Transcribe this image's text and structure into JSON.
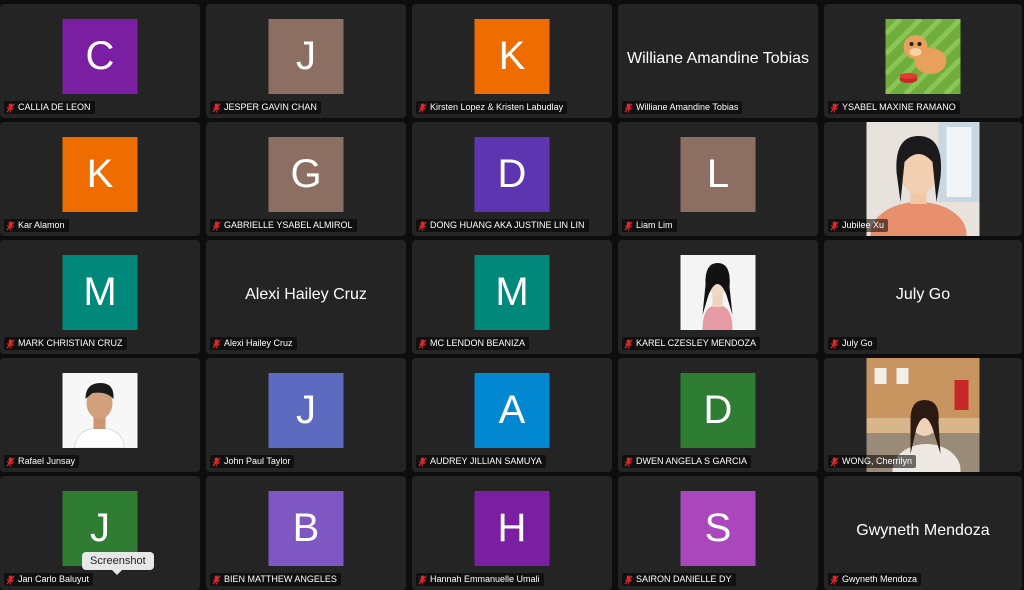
{
  "participants": [
    {
      "name": "CALLIA DE LEON",
      "initial": "C",
      "color": "#7b1fa2",
      "kind": "avatar",
      "muted": true
    },
    {
      "name": "JESPER GAVIN CHAN",
      "initial": "J",
      "color": "#8d6e63",
      "kind": "avatar",
      "muted": true
    },
    {
      "name": "Kirsten Lopez & Kristen Labudlay",
      "initial": "K",
      "color": "#ef6c00",
      "kind": "avatar",
      "muted": true
    },
    {
      "name": "Williane Amandine Tobias",
      "display": "Williane Amandine Tobias",
      "kind": "text",
      "muted": true
    },
    {
      "name": "YSABEL MAXINE RAMANO",
      "kind": "photo",
      "photo": "dog",
      "muted": true
    },
    {
      "name": "Kar Alamon",
      "initial": "K",
      "color": "#ef6c00",
      "kind": "avatar",
      "muted": true
    },
    {
      "name": "GABRIELLE YSABEL ALMIROL",
      "initial": "G",
      "color": "#8d6e63",
      "kind": "avatar",
      "muted": true
    },
    {
      "name": "DONG HUANG AKA JUSTINE LIN LIN",
      "initial": "D",
      "color": "#5e35b1",
      "kind": "avatar",
      "muted": true
    },
    {
      "name": "Liam Lim",
      "initial": "L",
      "color": "#8d6e63",
      "kind": "avatar",
      "muted": true
    },
    {
      "name": "Jubilee Xu",
      "kind": "photo",
      "photo": "girl-window",
      "muted": true
    },
    {
      "name": "MARK CHRISTIAN CRUZ",
      "initial": "M",
      "color": "#00897b",
      "kind": "avatar",
      "muted": true
    },
    {
      "name": "Alexi Hailey Cruz",
      "display": "Alexi Hailey Cruz",
      "kind": "text",
      "muted": true
    },
    {
      "name": "MC LENDON BEANIZA",
      "initial": "M",
      "color": "#00897b",
      "kind": "avatar",
      "muted": true
    },
    {
      "name": "KAREL CZESLEY MENDOZA",
      "kind": "photo",
      "photo": "girl-pink",
      "muted": true
    },
    {
      "name": "July Go",
      "display": "July Go",
      "kind": "text",
      "muted": true
    },
    {
      "name": "Rafael Junsay",
      "kind": "photo",
      "photo": "boy",
      "muted": true
    },
    {
      "name": "John Paul Taylor",
      "initial": "J",
      "color": "#5c6bc0",
      "kind": "avatar",
      "muted": true
    },
    {
      "name": "AUDREY JILLIAN SAMUYA",
      "initial": "A",
      "color": "#0288d1",
      "kind": "avatar",
      "muted": true
    },
    {
      "name": "DWEN ANGELA S GARCIA",
      "initial": "D",
      "color": "#2e7d32",
      "kind": "avatar",
      "muted": true
    },
    {
      "name": "WONG, Cherrilyn",
      "kind": "photo",
      "photo": "girl-street",
      "muted": true
    },
    {
      "name": "Jan Carlo Baluyut",
      "initial": "J",
      "color": "#2e7d32",
      "kind": "avatar",
      "muted": true
    },
    {
      "name": "BIEN MATTHEW ANGELES",
      "initial": "B",
      "color": "#7e57c2",
      "kind": "avatar",
      "muted": true
    },
    {
      "name": "Hannah Emmanuelle Umali",
      "initial": "H",
      "color": "#7b1fa2",
      "kind": "avatar",
      "muted": true
    },
    {
      "name": "SAIRON DANIELLE DY",
      "initial": "S",
      "color": "#ab47bc",
      "kind": "avatar",
      "muted": true
    },
    {
      "name": "Gwyneth Mendoza",
      "display": "Gwyneth Mendoza",
      "kind": "text",
      "muted": true
    }
  ],
  "tooltip": "Screenshot",
  "icons": {
    "muted_mic": "muted-mic-icon"
  },
  "colors": {
    "background": "#0d0d0d",
    "tile": "#242424",
    "mic_red": "#e02828"
  }
}
